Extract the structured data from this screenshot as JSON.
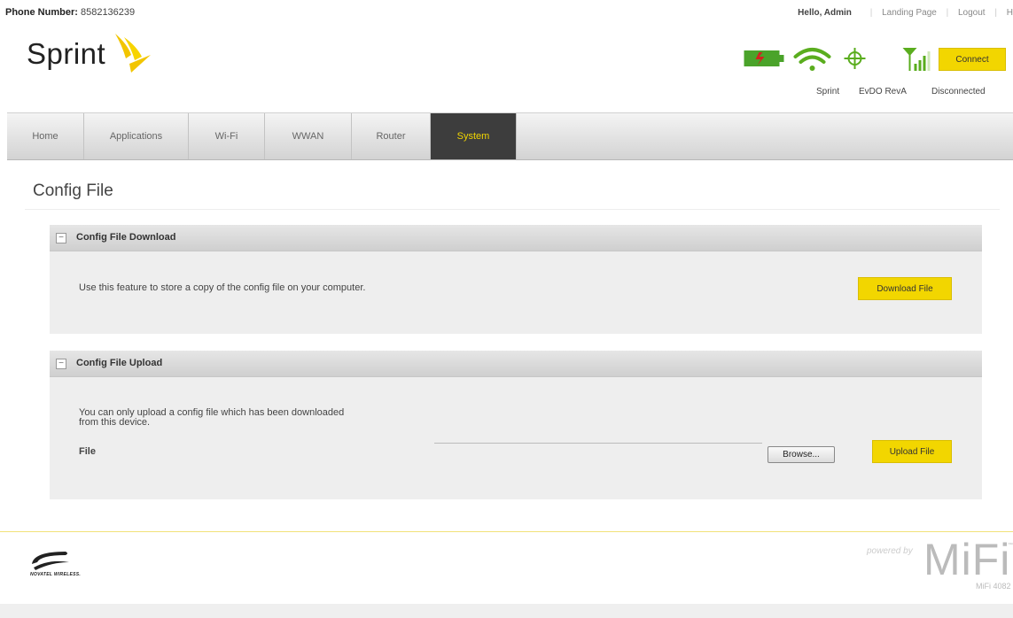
{
  "header": {
    "phone_label": "Phone Number:",
    "phone_value": "8582136239",
    "greeting": "Hello, Admin",
    "links": [
      "Landing Page",
      "Logout",
      "H"
    ],
    "logo_text": "Sprint"
  },
  "status": {
    "connect_label": "Connect",
    "carrier": "Sprint",
    "network": "EvDO RevA",
    "connection": "Disconnected"
  },
  "nav": {
    "tabs": [
      "Home",
      "Applications",
      "Wi-Fi",
      "WWAN",
      "Router",
      "System"
    ],
    "active": "System"
  },
  "page": {
    "title": "Config File"
  },
  "download_panel": {
    "title": "Config File Download",
    "description": "Use this feature to store a copy of the config file on your computer.",
    "button_label": "Download File"
  },
  "upload_panel": {
    "title": "Config File Upload",
    "description_line1": "You can only upload a config file which has been downloaded",
    "description_line2": "from this device.",
    "file_label": "File",
    "browse_label": "Browse...",
    "button_label": "Upload File"
  },
  "footer": {
    "vendor_text": "NOVATEL WIRELESS.",
    "powered_by": "powered by",
    "brand": "MiFi",
    "trademark": "™",
    "model": "MiFi 4082"
  },
  "colors": {
    "accent": "#f2d600",
    "nav_active_bg": "#3d3d3d",
    "battery": "#4aa32a",
    "signal": "#5aad1e"
  }
}
